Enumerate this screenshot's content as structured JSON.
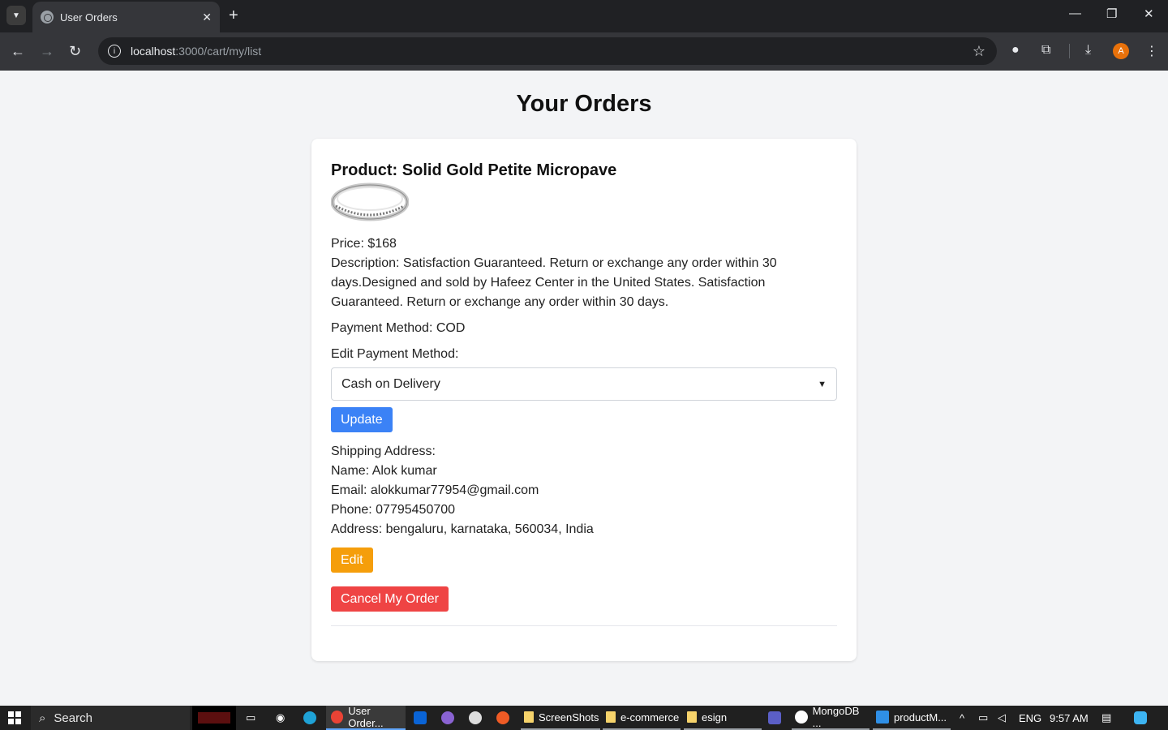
{
  "browser": {
    "tab_title": "User Orders",
    "url_host": "localhost",
    "url_rest": ":3000/cart/my/list",
    "avatar_letter": "A"
  },
  "page": {
    "title": "Your Orders"
  },
  "order": {
    "product_label": "Product: Solid Gold Petite Micropave",
    "price": "Price: $168",
    "description": "Description: Satisfaction Guaranteed. Return or exchange any order within 30 days.Designed and sold by Hafeez Center in the United States. Satisfaction Guaranteed. Return or exchange any order within 30 days.",
    "payment_method": "Payment Method: COD",
    "edit_payment_label": "Edit Payment Method:",
    "payment_select_value": "Cash on Delivery",
    "update_label": "Update",
    "shipping_heading": "Shipping Address:",
    "name": "Name: Alok kumar",
    "email": "Email: alokkumar77954@gmail.com",
    "phone": "Phone: 07795450700",
    "address": "Address: bengaluru, karnataka, 560034, India",
    "edit_label": "Edit",
    "cancel_label": "Cancel My Order"
  },
  "colors": {
    "update_button": "#3b82f6",
    "edit_button": "#f59e0b",
    "cancel_button": "#ef4444"
  },
  "taskbar": {
    "search_placeholder": "Search",
    "chrome_item": "User Order...",
    "folder_screenshots": "ScreenShots",
    "folder_ecommerce": "e-commerce",
    "folder_esign": "esign",
    "mongodb_item": "MongoDB ...",
    "vscode_item": "productM...",
    "lang": "ENG",
    "time": "9:57 AM"
  }
}
